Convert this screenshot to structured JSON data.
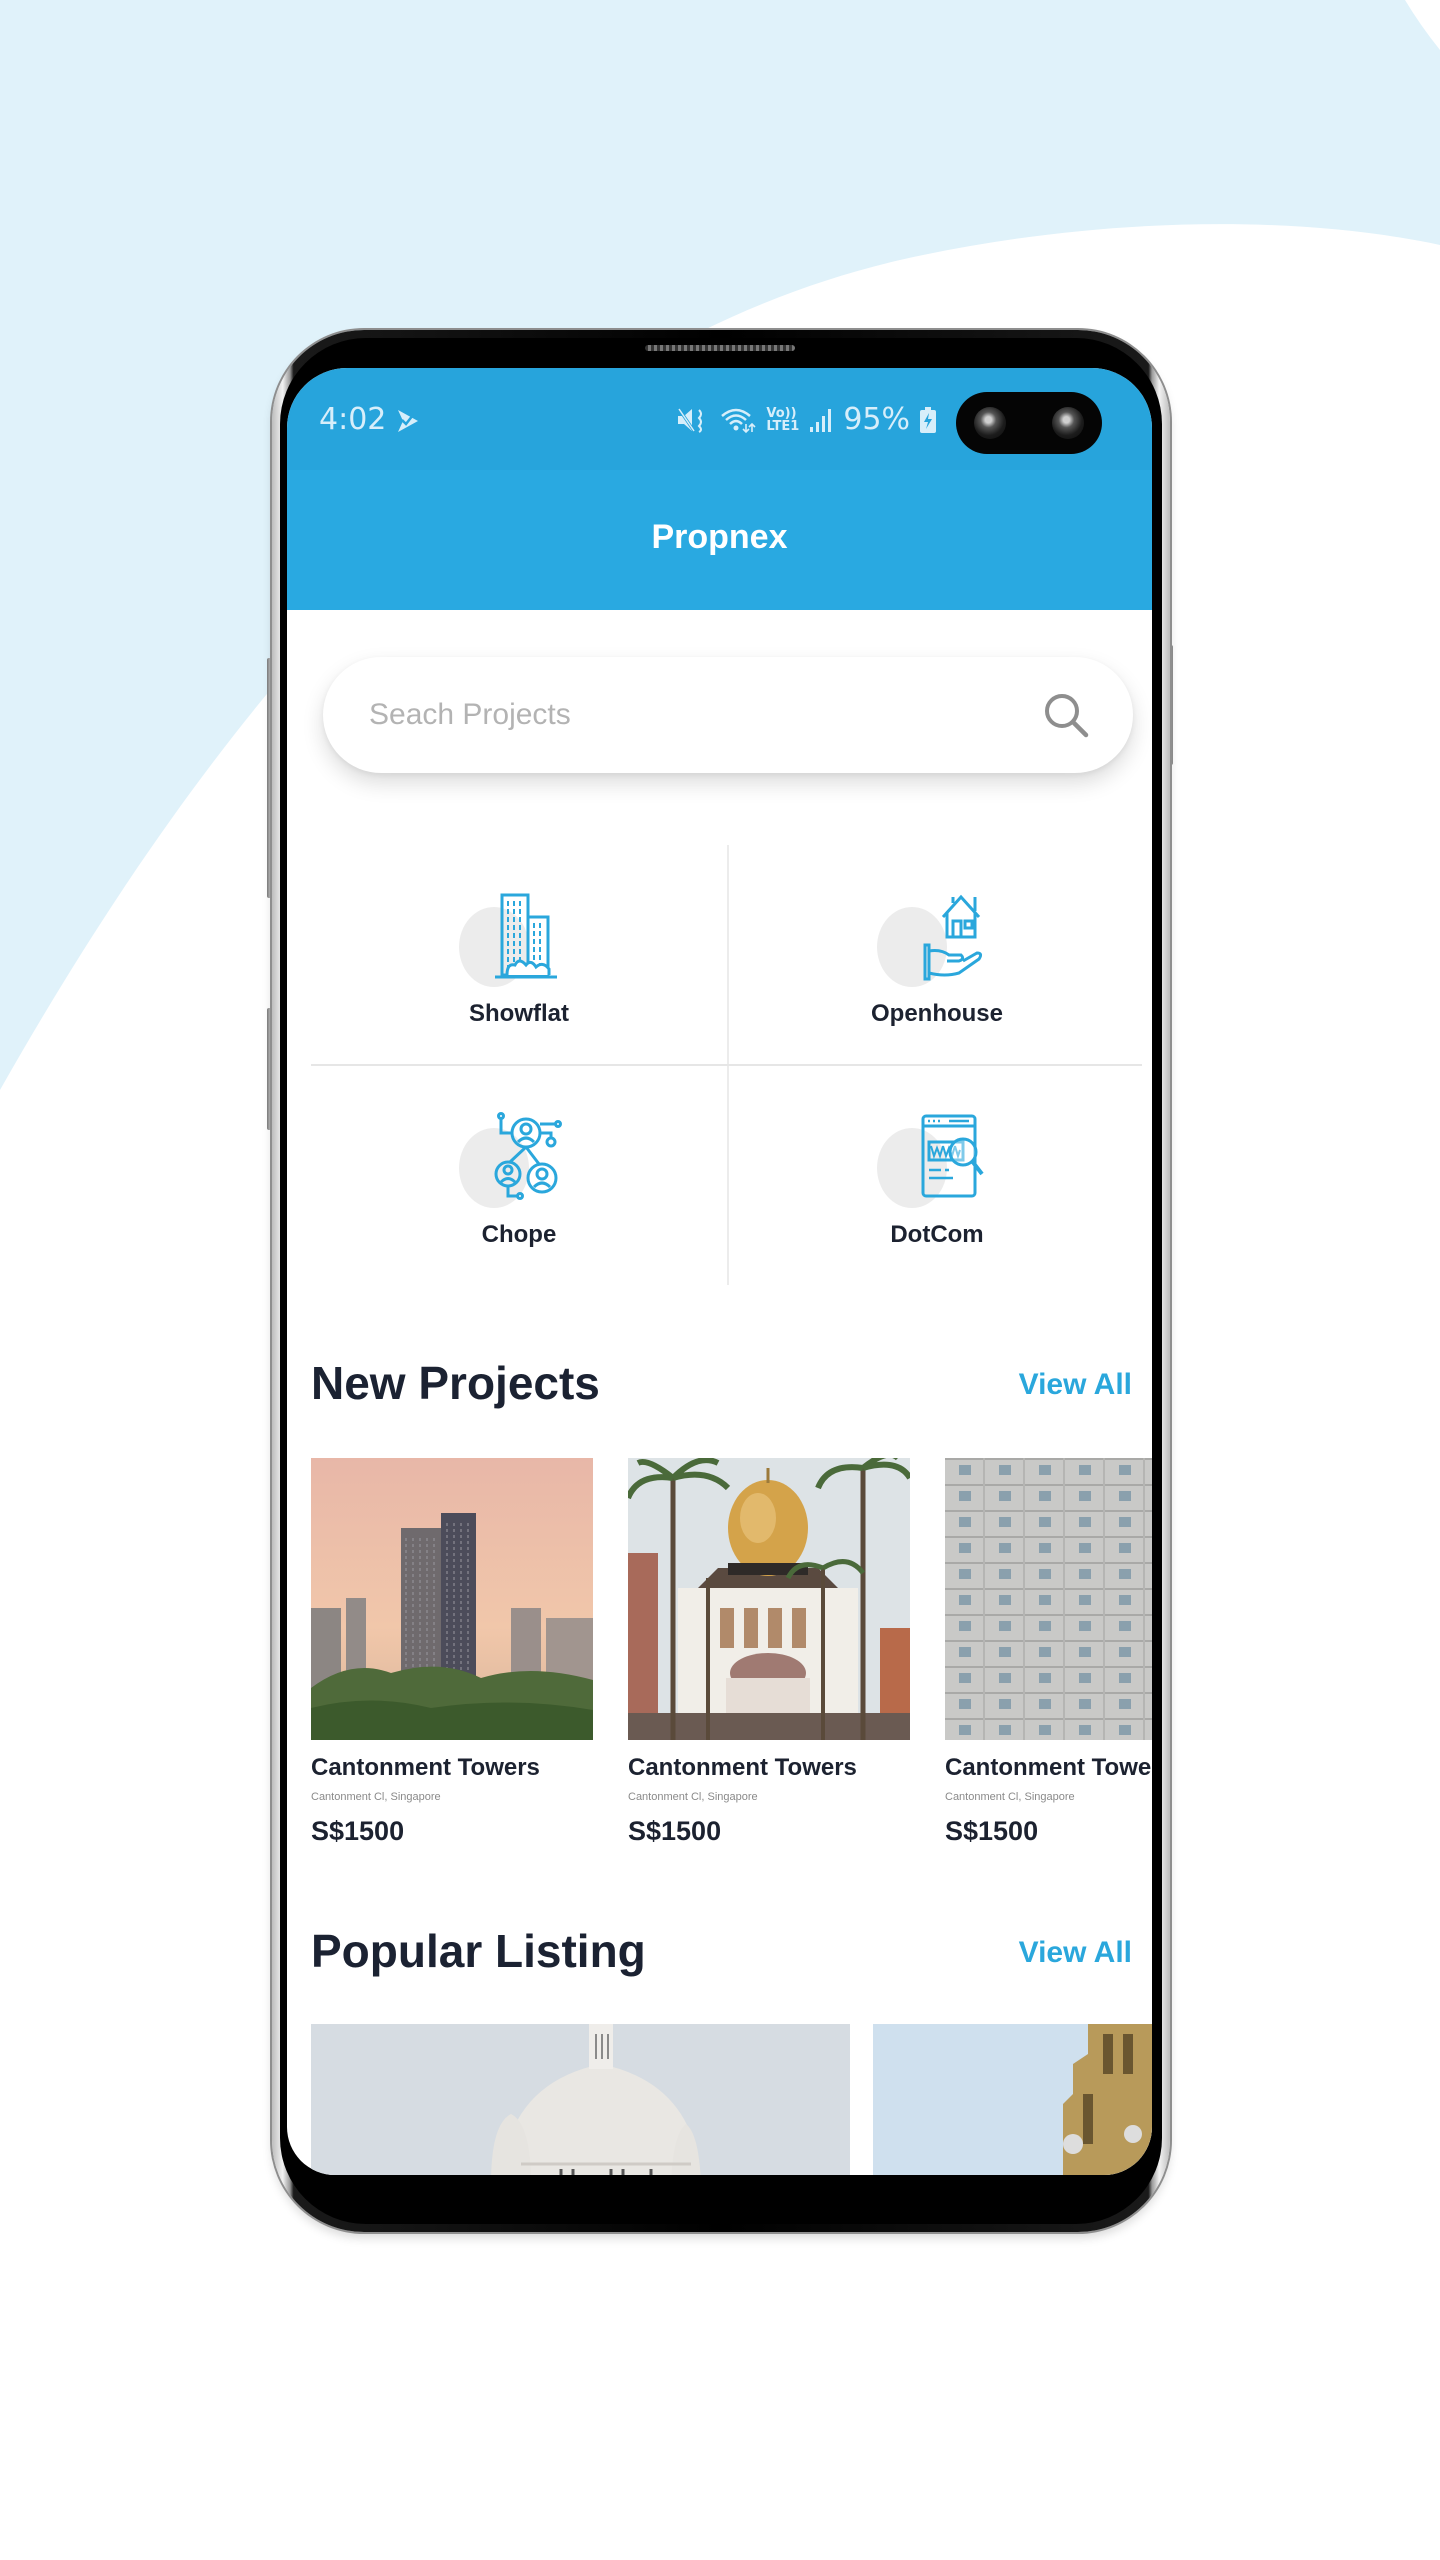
{
  "colors": {
    "brand": "#29a9e1",
    "status_bar": "#27a4dc",
    "accent_link": "#2aa7dc",
    "heading": "#1b2232",
    "background_wave": "#e0f2fa"
  },
  "status_bar": {
    "time": "4:02",
    "app_icon": "check-flag-icon",
    "icons": [
      "mute-vibrate-icon",
      "wifi-icon",
      "volte-lte1-icon",
      "signal-icon"
    ],
    "volte_label_top": "Vo))",
    "volte_label_bottom": "LTE1",
    "battery_percent": "95%",
    "battery_icon": "battery-charging-icon"
  },
  "app_bar": {
    "title": "Propnex"
  },
  "search": {
    "placeholder": "Seach Projects",
    "value": "",
    "icon": "search-icon"
  },
  "categories": [
    {
      "label": "Showflat",
      "icon": "buildings-icon"
    },
    {
      "label": "Openhouse",
      "icon": "house-in-hand-icon"
    },
    {
      "label": "Chope",
      "icon": "people-network-icon"
    },
    {
      "label": "DotCom",
      "icon": "browser-www-search-icon"
    }
  ],
  "new_projects": {
    "title": "New Projects",
    "view_all": "View All",
    "items": [
      {
        "name": "Cantonment Towers",
        "location": "Cantonment Cl, Singapore",
        "price": "S$1500",
        "image": "twin-towers-sunset-photo"
      },
      {
        "name": "Cantonment Towers",
        "location": "Cantonment Cl, Singapore",
        "price": "S$1500",
        "image": "golden-dome-mosque-photo"
      },
      {
        "name": "Cantonment Towers",
        "location": "Cantonment Cl, Singapore",
        "price": "S$1500",
        "image": "grey-apartment-facade-photo"
      }
    ]
  },
  "popular_listing": {
    "title": "Popular Listing",
    "view_all": "View All",
    "items": [
      {
        "image": "white-basilica-dome-photo"
      },
      {
        "image": "sandstone-tower-photo"
      }
    ]
  }
}
